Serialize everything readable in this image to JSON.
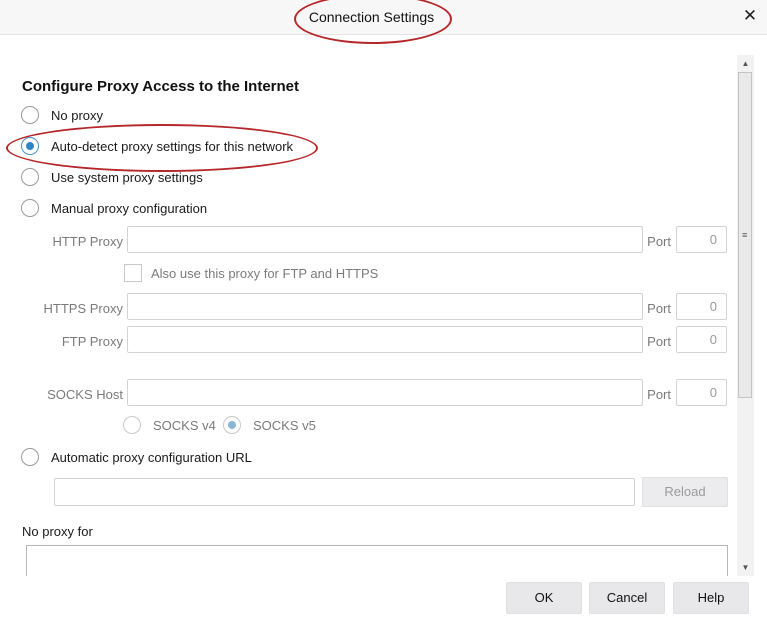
{
  "window": {
    "title": "Connection Settings",
    "close_icon": "close-icon"
  },
  "section": {
    "heading": "Configure Proxy Access to the Internet"
  },
  "proxy_options": [
    {
      "label": "No proxy",
      "selected": false
    },
    {
      "label": "Auto-detect proxy settings for this network",
      "selected": true
    },
    {
      "label": "Use system proxy settings",
      "selected": false
    },
    {
      "label": "Manual proxy configuration",
      "selected": false
    }
  ],
  "manual": {
    "http_label": "HTTP Proxy",
    "http_value": "",
    "http_port_label": "Port",
    "http_port": "0",
    "also_use_label": "Also use this proxy for FTP and HTTPS",
    "also_use_checked": false,
    "https_label": "HTTPS Proxy",
    "https_value": "",
    "https_port_label": "Port",
    "https_port": "0",
    "ftp_label": "FTP Proxy",
    "ftp_value": "",
    "ftp_port_label": "Port",
    "ftp_port": "0",
    "socks_label": "SOCKS Host",
    "socks_value": "",
    "socks_port_label": "Port",
    "socks_port": "0",
    "socks_v4_label": "SOCKS v4",
    "socks_v5_label": "SOCKS v5",
    "socks_v5_selected": true
  },
  "auto_url": {
    "label": "Automatic proxy configuration URL",
    "value": "",
    "reload_label": "Reload"
  },
  "no_proxy": {
    "label": "No proxy for",
    "value": ""
  },
  "footer": {
    "ok_label": "OK",
    "cancel_label": "Cancel",
    "help_label": "Help"
  },
  "colors": {
    "annotation_red": "#b5272b",
    "radio_accent": "#2f86c6"
  }
}
